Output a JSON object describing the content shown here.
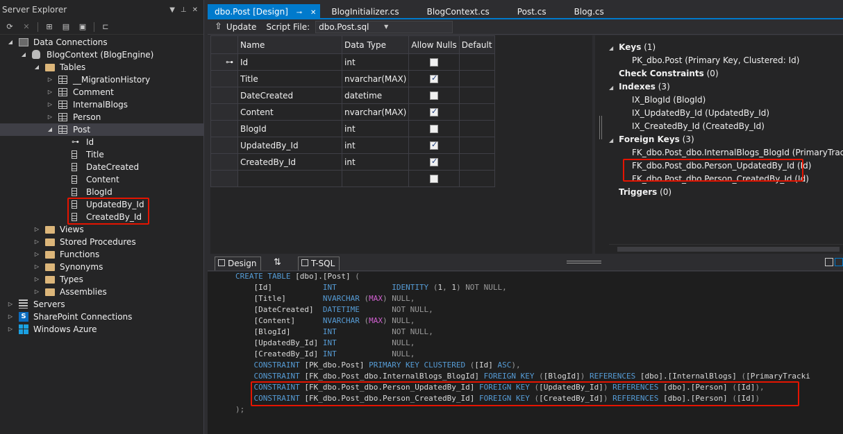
{
  "server_explorer": {
    "title": "Server Explorer",
    "toolbar_icons": [
      "refresh-icon",
      "stop-icon",
      "connect-db-icon",
      "connect-server-icon",
      "azure-icon",
      "filter-icon"
    ],
    "tree": [
      {
        "label": "Data Connections",
        "icon": "data-connections-icon",
        "expanded": true
      },
      {
        "label": "BlogContext (BlogEngine)",
        "icon": "database-icon",
        "expanded": true
      },
      {
        "label": "Tables",
        "icon": "folder-icon",
        "expanded": true
      },
      {
        "label": "__MigrationHistory",
        "icon": "table-icon"
      },
      {
        "label": "Comment",
        "icon": "table-icon"
      },
      {
        "label": "InternalBlogs",
        "icon": "table-icon"
      },
      {
        "label": "Person",
        "icon": "table-icon"
      },
      {
        "label": "Post",
        "icon": "table-icon",
        "expanded": true,
        "selected": true
      },
      {
        "label": "Id",
        "icon": "key-icon"
      },
      {
        "label": "Title",
        "icon": "column-icon"
      },
      {
        "label": "DateCreated",
        "icon": "column-icon"
      },
      {
        "label": "Content",
        "icon": "column-icon"
      },
      {
        "label": "BlogId",
        "icon": "column-icon"
      },
      {
        "label": "UpdatedBy_Id",
        "icon": "column-icon"
      },
      {
        "label": "CreatedBy_Id",
        "icon": "column-icon"
      },
      {
        "label": "Views",
        "icon": "folder-icon"
      },
      {
        "label": "Stored Procedures",
        "icon": "folder-icon"
      },
      {
        "label": "Functions",
        "icon": "folder-icon"
      },
      {
        "label": "Synonyms",
        "icon": "folder-icon"
      },
      {
        "label": "Types",
        "icon": "folder-icon"
      },
      {
        "label": "Assemblies",
        "icon": "folder-icon"
      },
      {
        "label": "Servers",
        "icon": "servers-icon"
      },
      {
        "label": "SharePoint Connections",
        "icon": "sharepoint-icon"
      },
      {
        "label": "Windows Azure",
        "icon": "windows-azure-icon"
      }
    ]
  },
  "tabs": [
    {
      "label": "dbo.Post [Design]",
      "active": true
    },
    {
      "label": "BlogInitializer.cs"
    },
    {
      "label": "BlogContext.cs"
    },
    {
      "label": "Post.cs"
    },
    {
      "label": "Blog.cs"
    }
  ],
  "designer_toolbar": {
    "update_label": "Update",
    "script_file_label": "Script File:",
    "script_file_value": "dbo.Post.sql"
  },
  "grid": {
    "headers": [
      "Name",
      "Data Type",
      "Allow Nulls",
      "Default"
    ],
    "rows": [
      {
        "name": "Id",
        "type": "int",
        "allow_nulls": false,
        "key": true
      },
      {
        "name": "Title",
        "type": "nvarchar(MAX)",
        "allow_nulls": true
      },
      {
        "name": "DateCreated",
        "type": "datetime",
        "allow_nulls": false
      },
      {
        "name": "Content",
        "type": "nvarchar(MAX)",
        "allow_nulls": true
      },
      {
        "name": "BlogId",
        "type": "int",
        "allow_nulls": false
      },
      {
        "name": "UpdatedBy_Id",
        "type": "int",
        "allow_nulls": true
      },
      {
        "name": "CreatedBy_Id",
        "type": "int",
        "allow_nulls": true
      },
      {
        "name": "",
        "type": "",
        "allow_nulls": false
      }
    ]
  },
  "properties": {
    "keys": {
      "label": "Keys",
      "count": "(1)",
      "items": [
        "PK_dbo.Post   (Primary Key, Clustered: Id)"
      ]
    },
    "check_constraints": {
      "label": "Check Constraints",
      "count": "(0)"
    },
    "indexes": {
      "label": "Indexes",
      "count": "(3)",
      "items": [
        "IX_BlogId   (BlogId)",
        "IX_UpdatedBy_Id   (UpdatedBy_Id)",
        "IX_CreatedBy_Id   (CreatedBy_Id)"
      ]
    },
    "foreign_keys": {
      "label": "Foreign Keys",
      "count": "(3)",
      "items": [
        "FK_dbo.Post_dbo.InternalBlogs_BlogId   (PrimaryTracking",
        "FK_dbo.Post_dbo.Person_UpdatedBy_Id   (Id)",
        "FK_dbo.Post_dbo.Person_CreatedBy_Id   (Id)"
      ]
    },
    "triggers": {
      "label": "Triggers",
      "count": "(0)"
    }
  },
  "view_tabs": {
    "design": "Design",
    "tsql": "T-SQL"
  },
  "sql_lines": [
    [
      [
        "kw",
        "CREATE TABLE "
      ],
      [
        "tx",
        "[dbo].[Post] "
      ],
      [
        "gr",
        "("
      ]
    ],
    [
      [
        "tx",
        "    [Id]           "
      ],
      [
        "kw",
        "INT"
      ],
      [
        "tx",
        "            "
      ],
      [
        "kw",
        "IDENTITY "
      ],
      [
        "gr",
        "("
      ],
      [
        "tx",
        "1"
      ],
      [
        "gr",
        ", "
      ],
      [
        "tx",
        "1"
      ],
      [
        "gr",
        ") "
      ],
      [
        "gr",
        "NOT NULL"
      ],
      [
        "gr",
        ","
      ]
    ],
    [
      [
        "tx",
        "    [Title]        "
      ],
      [
        "kw",
        "NVARCHAR "
      ],
      [
        "gr",
        "("
      ],
      [
        "fn",
        "MAX"
      ],
      [
        "gr",
        ") "
      ],
      [
        "gr",
        "NULL"
      ],
      [
        "gr",
        ","
      ]
    ],
    [
      [
        "tx",
        "    [DateCreated]  "
      ],
      [
        "kw",
        "DATETIME"
      ],
      [
        "tx",
        "       "
      ],
      [
        "gr",
        "NOT NULL"
      ],
      [
        "gr",
        ","
      ]
    ],
    [
      [
        "tx",
        "    [Content]      "
      ],
      [
        "kw",
        "NVARCHAR "
      ],
      [
        "gr",
        "("
      ],
      [
        "fn",
        "MAX"
      ],
      [
        "gr",
        ") "
      ],
      [
        "gr",
        "NULL"
      ],
      [
        "gr",
        ","
      ]
    ],
    [
      [
        "tx",
        "    [BlogId]       "
      ],
      [
        "kw",
        "INT"
      ],
      [
        "tx",
        "            "
      ],
      [
        "gr",
        "NOT NULL"
      ],
      [
        "gr",
        ","
      ]
    ],
    [
      [
        "tx",
        "    [UpdatedBy_Id] "
      ],
      [
        "kw",
        "INT"
      ],
      [
        "tx",
        "            "
      ],
      [
        "gr",
        "NULL"
      ],
      [
        "gr",
        ","
      ]
    ],
    [
      [
        "tx",
        "    [CreatedBy_Id] "
      ],
      [
        "kw",
        "INT"
      ],
      [
        "tx",
        "            "
      ],
      [
        "gr",
        "NULL"
      ],
      [
        "gr",
        ","
      ]
    ],
    [
      [
        "tx",
        "    "
      ],
      [
        "kw",
        "CONSTRAINT "
      ],
      [
        "tx",
        "[PK_dbo.Post] "
      ],
      [
        "kw",
        "PRIMARY KEY CLUSTERED "
      ],
      [
        "gr",
        "("
      ],
      [
        "tx",
        "[Id] "
      ],
      [
        "kw",
        "ASC"
      ],
      [
        "gr",
        "),"
      ]
    ],
    [
      [
        "tx",
        "    "
      ],
      [
        "kw",
        "CONSTRAINT "
      ],
      [
        "tx",
        "[FK_dbo.Post_dbo.InternalBlogs_BlogId] "
      ],
      [
        "kw",
        "FOREIGN KEY "
      ],
      [
        "gr",
        "("
      ],
      [
        "tx",
        "[BlogId]"
      ],
      [
        "gr",
        ") "
      ],
      [
        "kw",
        "REFERENCES "
      ],
      [
        "tx",
        "[dbo].[InternalBlogs] "
      ],
      [
        "gr",
        "("
      ],
      [
        "tx",
        "[PrimaryTracki"
      ]
    ],
    [
      [
        "tx",
        "    "
      ],
      [
        "kw",
        "CONSTRAINT "
      ],
      [
        "tx",
        "[FK_dbo.Post_dbo.Person_UpdatedBy_Id] "
      ],
      [
        "kw",
        "FOREIGN KEY "
      ],
      [
        "gr",
        "("
      ],
      [
        "tx",
        "[UpdatedBy_Id]"
      ],
      [
        "gr",
        ") "
      ],
      [
        "kw",
        "REFERENCES "
      ],
      [
        "tx",
        "[dbo].[Person] "
      ],
      [
        "gr",
        "("
      ],
      [
        "tx",
        "[Id]"
      ],
      [
        "gr",
        "),"
      ]
    ],
    [
      [
        "tx",
        "    "
      ],
      [
        "kw",
        "CONSTRAINT "
      ],
      [
        "tx",
        "[FK_dbo.Post_dbo.Person_CreatedBy_Id] "
      ],
      [
        "kw",
        "FOREIGN KEY "
      ],
      [
        "gr",
        "("
      ],
      [
        "tx",
        "[CreatedBy_Id]"
      ],
      [
        "gr",
        ") "
      ],
      [
        "kw",
        "REFERENCES "
      ],
      [
        "tx",
        "[dbo].[Person] "
      ],
      [
        "gr",
        "("
      ],
      [
        "tx",
        "[Id]"
      ],
      [
        "gr",
        ")"
      ]
    ],
    [
      [
        "gr",
        ");"
      ]
    ]
  ],
  "colors": {
    "accent": "#007acc",
    "highlight_box": "#e51400"
  }
}
